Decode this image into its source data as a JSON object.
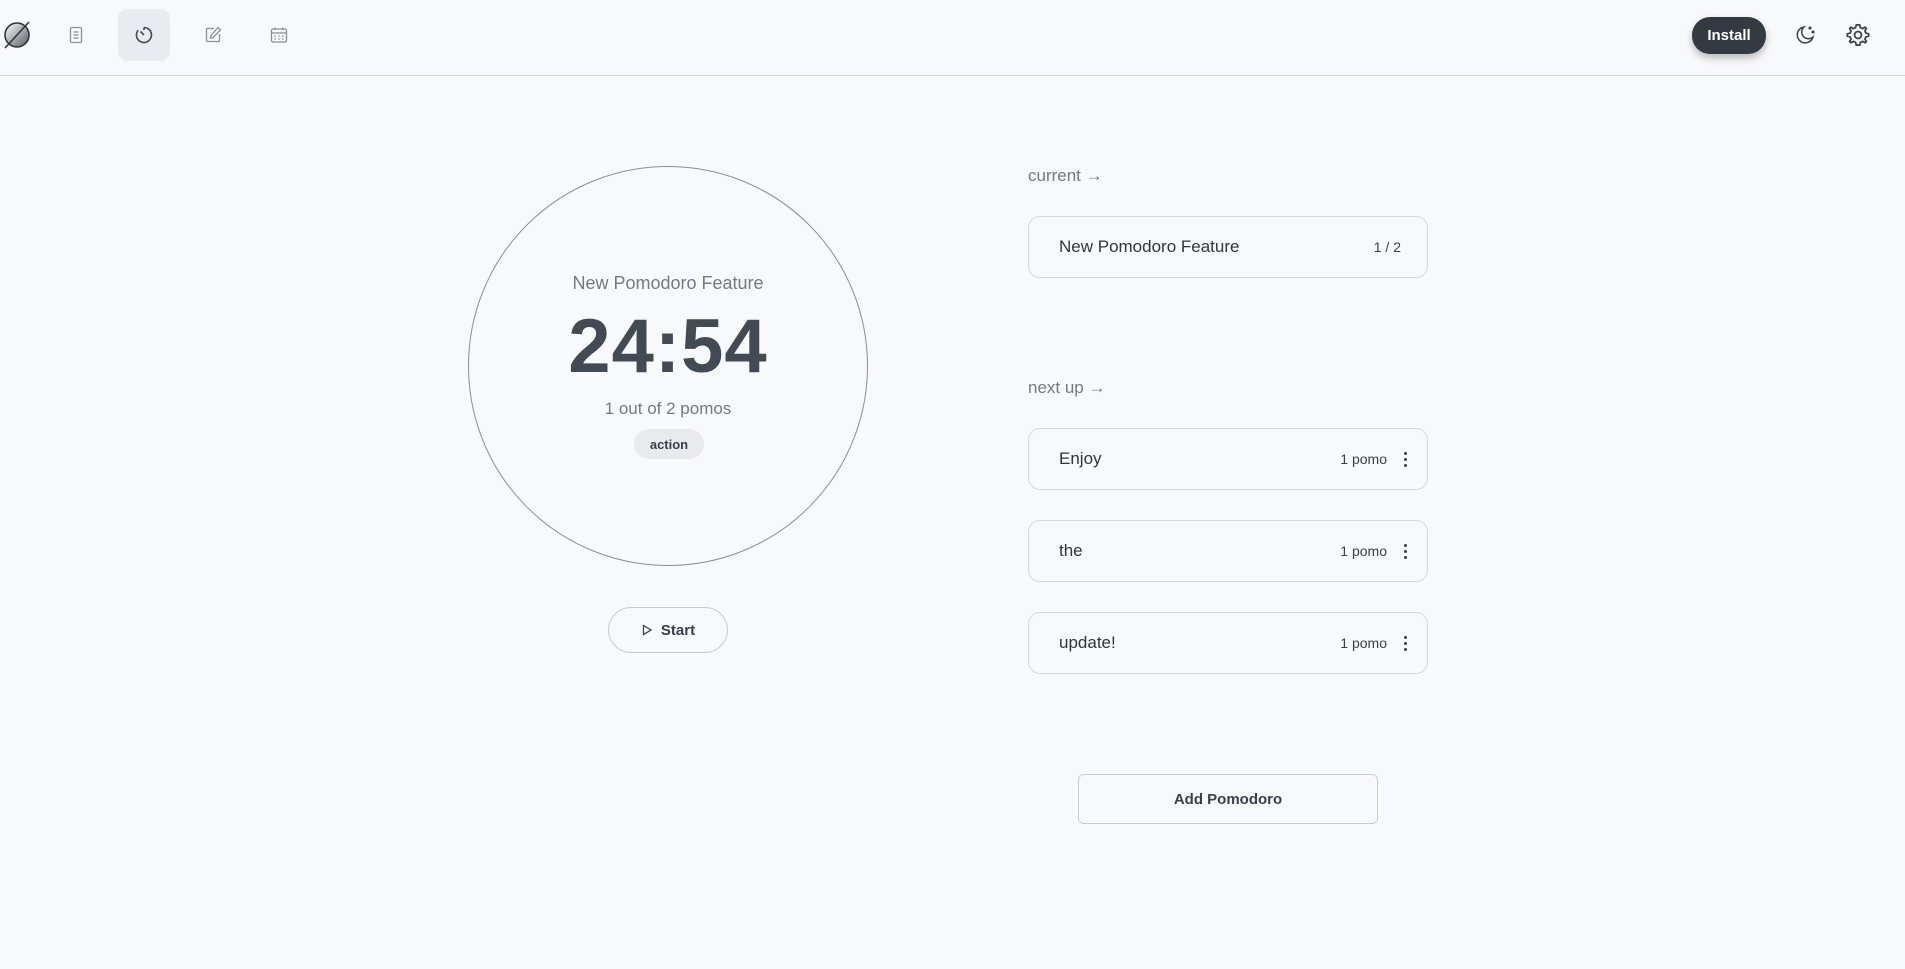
{
  "header": {
    "nav": [
      {
        "icon": "document-icon",
        "name": "notes"
      },
      {
        "icon": "timer-icon",
        "name": "pomodoro",
        "active": true
      },
      {
        "icon": "edit-icon",
        "name": "editor"
      },
      {
        "icon": "calendar-icon",
        "name": "calendar"
      }
    ],
    "install_label": "Install"
  },
  "timer": {
    "task_name": "New Pomodoro Feature",
    "time": "24:54",
    "progress": "1 out of 2 pomos",
    "tag": "action",
    "start_label": "Start"
  },
  "current": {
    "label": "current →",
    "task": {
      "title": "New Pomodoro Feature",
      "count": "1 / 2"
    }
  },
  "next_up": {
    "label": "next up →",
    "items": [
      {
        "title": "Enjoy",
        "pomos": "1 pomo"
      },
      {
        "title": "the",
        "pomos": "1 pomo"
      },
      {
        "title": "update!",
        "pomos": "1 pomo"
      }
    ]
  },
  "add_button_label": "Add Pomodoro",
  "colors": {
    "background": "#f8f9fb",
    "primary_dark": "#333a42",
    "border": "#d5d9de"
  }
}
